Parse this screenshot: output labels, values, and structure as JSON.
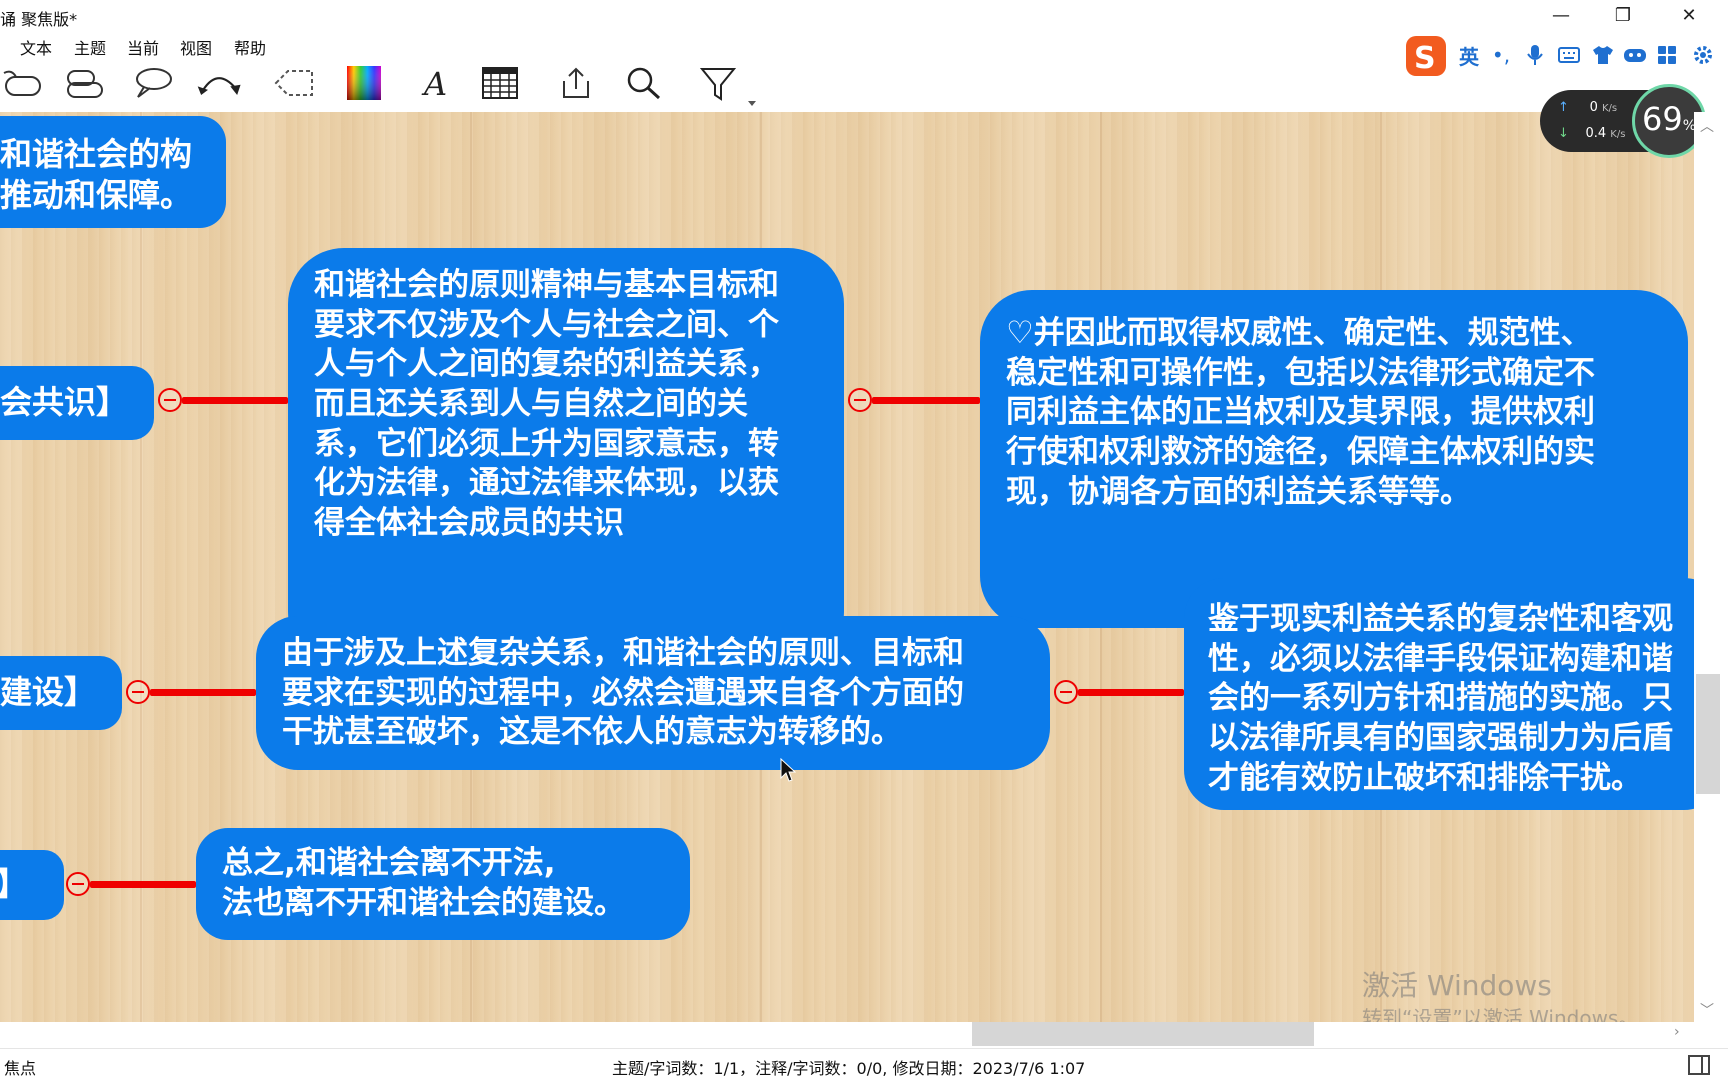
{
  "window": {
    "title": "诵 聚焦版*",
    "minimize_glyph": "—",
    "restore_glyph": "❐",
    "close_glyph": "✕"
  },
  "menu": {
    "items": [
      "文本",
      "主题",
      "当前",
      "视图",
      "帮助"
    ]
  },
  "toolbar": {
    "tools": [
      "callout-shape-icon",
      "cloud-shape-icon",
      "speech-bubble-icon",
      "relationship-arrow-icon",
      "boundary-icon",
      "color-palette-icon",
      "font-icon",
      "table-icon",
      "export-icon",
      "search-icon",
      "filter-icon",
      "more-dropdown-icon"
    ]
  },
  "ime": {
    "lang": "英",
    "punct": "•,",
    "icons": [
      "microphone-icon",
      "keyboard-icon",
      "skin-icon",
      "gamepad-icon",
      "apps-grid-icon",
      "settings-icon"
    ]
  },
  "network": {
    "upload": "0",
    "upload_unit": "K/s",
    "download": "0.4",
    "download_unit": "K/s",
    "percent": "69",
    "percent_sign": "%"
  },
  "mindmap": {
    "nodes": [
      {
        "id": "top-left",
        "text": "和谐社会的构\n推动和保障。"
      },
      {
        "id": "row1-left",
        "text": "会共识】"
      },
      {
        "id": "row1-middle",
        "text": "和谐社会的原则精神与基本目标和\n要求不仅涉及个人与社会之间、个\n人与个人之间的复杂的利益关系，\n而且还关系到人与自然之间的关\n系，它们必须上升为国家意志，转\n化为法律，通过法律来体现，以获\n得全体社会成员的共识"
      },
      {
        "id": "row1-right",
        "text": "♡并因此而取得权威性、确定性、规范性、\n稳定性和可操作性，包括以法律形式确定不\n同利益主体的正当权利及其界限，提供权利\n行使和权利救济的途径，保障主体权利的实\n现，协调各方面的利益关系等等。"
      },
      {
        "id": "row2-left",
        "text": "建设】"
      },
      {
        "id": "row2-middle",
        "text": "由于涉及上述复杂关系，和谐社会的原则、目标和\n要求在实现的过程中，必然会遭遇来自各个方面的\n干扰甚至破坏，这是不依人的意志为转移的。"
      },
      {
        "id": "row2-right",
        "text": "鉴于现实利益关系的复杂性和客观\n性，必须以法律手段保证构建和谐\n会的一系列方针和措施的实施。只\n以法律所具有的国家强制力为后盾\n才能有效防止破坏和排除干扰。"
      },
      {
        "id": "row3-left",
        "text": "】"
      },
      {
        "id": "row3-middle",
        "text": "总之,和谐社会离不开法,\n法也离不开和谐社会的建设。"
      }
    ]
  },
  "watermark": {
    "line1": "激活 Windows",
    "line2": "转到“设置”以激活 Windows。"
  },
  "status": {
    "left": "焦点",
    "center": "主题/字词数：1/1，注释/字词数：0/0, 修改日期：2023/7/6 1:07"
  },
  "colors": {
    "node_fill": "#0b7bea",
    "connector": "#ef0000",
    "wood": "#ecd2a9"
  }
}
